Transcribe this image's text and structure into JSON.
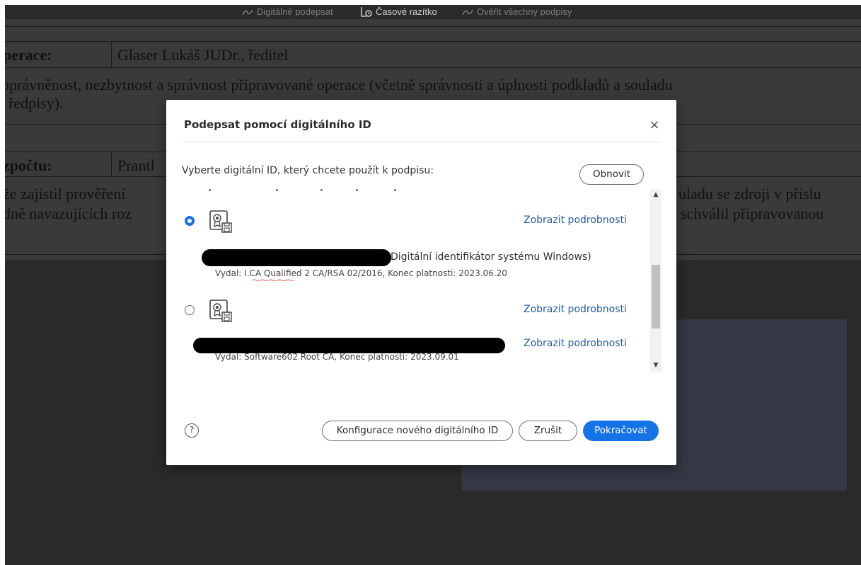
{
  "toolbar": {
    "sign_label": "Digitálně podepsat",
    "timestamp_label": "Časové razítko",
    "verify_label": "Ověřit všechny podpisy"
  },
  "document": {
    "row1_label": "perace:",
    "row1_value": "Glaser Lukáš JUDr., ředitel",
    "para1_line1": "oprávněnost, nezbytnost a správnost připravované operace (včetně správnosti a úplnosti podkladů a souladu",
    "para1_line2": "ředpisy).",
    "row2_label": "zpočtu:",
    "row2_value": "Prantl",
    "para2_line1_left": "že zajistil prověření",
    "para2_line1_right": "uladu se zdroji v příslu",
    "para2_line2_left": "dně navazujících roz",
    "para2_line2_right": "schválil připravovanou"
  },
  "dialog": {
    "title": "Podepsat pomocí digitálního ID",
    "close_symbol": "×",
    "prompt": "Vyberte digitální ID, který chcete použít k podpisu:",
    "refresh_label": "Obnovit",
    "details_label": "Zobrazit podrobnosti",
    "certificates": [
      {
        "selected": true,
        "name_suffix": "Digitální identifikátor systému Windows)",
        "issuer_line": "Vydal: I.CA Qualified 2 CA/RSA 02/2016, Konec platnosti: 2023.06.20"
      },
      {
        "selected": false,
        "name_suffix": "",
        "issuer_line": "Vydal: Software602 Root CA, Konec platnosti: 2023.09.01"
      }
    ],
    "help_symbol": "?",
    "configure_label": "Konfigurace nového digitálního ID",
    "cancel_label": "Zrušit",
    "continue_label": "Pokračovat"
  },
  "icons": {
    "certificate": "certificate-icon",
    "signature": "signature-pen-icon",
    "timestamp": "timestamp-icon"
  },
  "colors": {
    "accent": "#1473e6",
    "link": "#1f5fa8",
    "overlay": "#2a2a2a"
  }
}
